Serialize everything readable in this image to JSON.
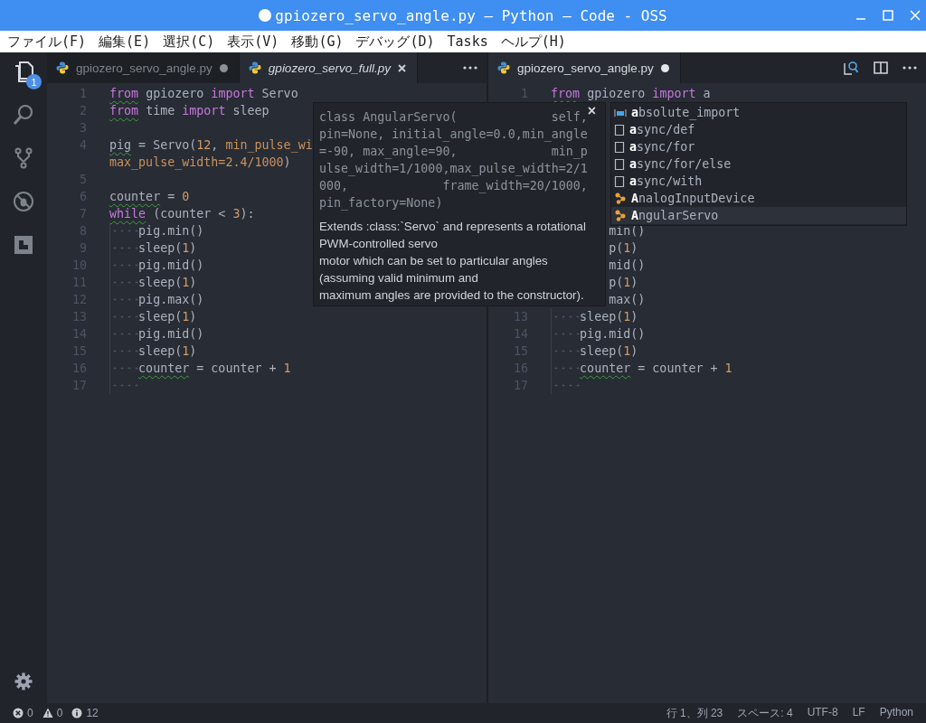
{
  "window": {
    "title": "gpiozero_servo_angle.py — Python — Code - OSS",
    "dirty": true
  },
  "menu": [
    "ファイル(F)",
    "編集(E)",
    "選択(C)",
    "表示(V)",
    "移動(G)",
    "デバッグ(D)",
    "Tasks",
    "ヘルプ(H)"
  ],
  "activity_bar": [
    {
      "kind": "files",
      "selected": true,
      "badge": "1"
    },
    {
      "kind": "search",
      "selected": false
    },
    {
      "kind": "source-control",
      "selected": false
    },
    {
      "kind": "debug",
      "selected": false
    },
    {
      "kind": "extensions",
      "selected": false
    }
  ],
  "editor_groups": [
    {
      "tabs": [
        {
          "label": "gpiozero_servo_angle.py",
          "selected": false,
          "dirty": true,
          "preview": false
        },
        {
          "label": "gpiozero_servo_full.py",
          "selected": true,
          "dirty": false,
          "preview": true
        }
      ],
      "lines": [
        {
          "kind": "code",
          "number": "1",
          "segments": [
            {
              "text": "from",
              "kind": "keyword",
              "warning": true
            },
            {
              "text": " gpiozero ",
              "kind": "plain"
            },
            {
              "text": "import",
              "kind": "keyword"
            },
            {
              "text": " Servo",
              "kind": "plain"
            }
          ]
        },
        {
          "kind": "code",
          "number": "2",
          "segments": [
            {
              "text": "from",
              "kind": "keyword",
              "warning": true
            },
            {
              "text": " time ",
              "kind": "plain"
            },
            {
              "text": "import",
              "kind": "keyword"
            },
            {
              "text": " sleep",
              "kind": "plain"
            }
          ]
        },
        {
          "kind": "code",
          "number": "3"
        },
        {
          "kind": "code",
          "number": "4",
          "segments": [
            {
              "text": "pig",
              "kind": "plain",
              "warning": true
            },
            {
              "text": " = Servo(",
              "kind": "plain"
            },
            {
              "text": "12",
              "kind": "number"
            },
            {
              "text": ", ",
              "kind": "plain"
            },
            {
              "text": "min_pulse_wi",
              "kind": "param"
            }
          ]
        },
        {
          "kind": "wrap",
          "segments": [
            {
              "text": "max_pulse_width=2.4/1000",
              "kind": "param"
            },
            {
              "text": ")",
              "kind": "plain"
            }
          ]
        },
        {
          "kind": "code",
          "number": "5"
        },
        {
          "kind": "code",
          "number": "6",
          "segments": [
            {
              "text": "counter",
              "kind": "plain",
              "warning": true
            },
            {
              "text": " = ",
              "kind": "plain"
            },
            {
              "text": "0",
              "kind": "number"
            }
          ]
        },
        {
          "kind": "code",
          "number": "7",
          "segments": [
            {
              "text": "while",
              "kind": "keyword",
              "warning": true
            },
            {
              "text": " (counter < ",
              "kind": "plain"
            },
            {
              "text": "3",
              "kind": "number"
            },
            {
              "text": "):",
              "kind": "plain"
            }
          ]
        },
        {
          "kind": "code",
          "number": "8",
          "indented": true,
          "segments": [
            {
              "text": "pig.min()",
              "kind": "plain"
            }
          ]
        },
        {
          "kind": "code",
          "number": "9",
          "indented": true,
          "segments": [
            {
              "text": "sleep(",
              "kind": "plain"
            },
            {
              "text": "1",
              "kind": "number"
            },
            {
              "text": ")",
              "kind": "plain"
            }
          ]
        },
        {
          "kind": "code",
          "number": "10",
          "indented": true,
          "segments": [
            {
              "text": "pig.mid()",
              "kind": "plain"
            }
          ]
        },
        {
          "kind": "code",
          "number": "11",
          "indented": true,
          "segments": [
            {
              "text": "sleep(",
              "kind": "plain"
            },
            {
              "text": "1",
              "kind": "number"
            },
            {
              "text": ")",
              "kind": "plain"
            }
          ]
        },
        {
          "kind": "code",
          "number": "12",
          "indented": true,
          "segments": [
            {
              "text": "pig.max()",
              "kind": "plain"
            }
          ]
        },
        {
          "kind": "code",
          "number": "13",
          "indented": true,
          "segments": [
            {
              "text": "sleep(",
              "kind": "plain"
            },
            {
              "text": "1",
              "kind": "number"
            },
            {
              "text": ")",
              "kind": "plain"
            }
          ]
        },
        {
          "kind": "code",
          "number": "14",
          "indented": true,
          "segments": [
            {
              "text": "pig.mid()",
              "kind": "plain"
            }
          ]
        },
        {
          "kind": "code",
          "number": "15",
          "indented": true,
          "segments": [
            {
              "text": "sleep(",
              "kind": "plain"
            },
            {
              "text": "1",
              "kind": "number"
            },
            {
              "text": ")",
              "kind": "plain"
            }
          ]
        },
        {
          "kind": "code",
          "number": "16",
          "indented": true,
          "segments": [
            {
              "text": "counter",
              "kind": "plain",
              "warning": true
            },
            {
              "text": " = counter + ",
              "kind": "plain"
            },
            {
              "text": "1",
              "kind": "number"
            }
          ]
        },
        {
          "kind": "code",
          "number": "17",
          "indented": true
        }
      ]
    },
    {
      "tabs": [
        {
          "label": "gpiozero_servo_angle.py",
          "selected": true,
          "dirty": true,
          "preview": false
        }
      ],
      "lines": [
        {
          "kind": "code",
          "number": "1",
          "segments": [
            {
              "text": "from",
              "kind": "keyword",
              "warning": true
            },
            {
              "text": " gpiozero ",
              "kind": "plain"
            },
            {
              "text": "import",
              "kind": "keyword"
            },
            {
              "text": " a",
              "kind": "plain"
            }
          ]
        },
        {
          "kind": "hidden"
        },
        {
          "kind": "hidden"
        },
        {
          "kind": "hidden"
        },
        {
          "kind": "hidden"
        },
        {
          "kind": "hidden"
        },
        {
          "kind": "hidden"
        },
        {
          "kind": "hidden"
        },
        {
          "kind": "covered",
          "segments": [
            {
              "text": "min()",
              "kind": "plain"
            }
          ]
        },
        {
          "kind": "covered",
          "segments": [
            {
              "text": "p(",
              "kind": "plain"
            },
            {
              "text": "1",
              "kind": "number"
            },
            {
              "text": ")",
              "kind": "plain"
            }
          ]
        },
        {
          "kind": "covered",
          "segments": [
            {
              "text": "mid()",
              "kind": "plain"
            }
          ]
        },
        {
          "kind": "covered",
          "segments": [
            {
              "text": "p(",
              "kind": "plain"
            },
            {
              "text": "1",
              "kind": "number"
            },
            {
              "text": ")",
              "kind": "plain"
            }
          ]
        },
        {
          "kind": "covered",
          "segments": [
            {
              "text": "max()",
              "kind": "plain"
            }
          ]
        },
        {
          "kind": "code",
          "number": "13",
          "indented": true,
          "segments": [
            {
              "text": "sleep(",
              "kind": "plain"
            },
            {
              "text": "1",
              "kind": "number"
            },
            {
              "text": ")",
              "kind": "plain"
            }
          ]
        },
        {
          "kind": "code",
          "number": "14",
          "indented": true,
          "segments": [
            {
              "text": "pig.mid()",
              "kind": "plain"
            }
          ]
        },
        {
          "kind": "code",
          "number": "15",
          "indented": true,
          "segments": [
            {
              "text": "sleep(",
              "kind": "plain"
            },
            {
              "text": "1",
              "kind": "number"
            },
            {
              "text": ")",
              "kind": "plain"
            }
          ]
        },
        {
          "kind": "code",
          "number": "16",
          "indented": true,
          "segments": [
            {
              "text": "counter",
              "kind": "plain",
              "warning": true
            },
            {
              "text": " = counter + ",
              "kind": "plain"
            },
            {
              "text": "1",
              "kind": "number"
            }
          ]
        },
        {
          "kind": "code",
          "number": "17",
          "indented": true
        }
      ]
    }
  ],
  "hover": {
    "close": "×",
    "signature": [
      "class AngularServo(             self,",
      "pin=None, initial_angle=0.0,min_angle",
      "=-90, max_angle=90,             min_p",
      "ulse_width=1/1000,max_pulse_width=2/1",
      "000,             frame_width=20/1000,",
      "pin_factory=None)"
    ],
    "docs": [
      "Extends :class:`Servo` and represents a rotational",
      "PWM-controlled servo",
      "motor which can be set to particular angles",
      "(assuming valid minimum and",
      "maximum angles are provided to the constructor)."
    ]
  },
  "suggestions": [
    {
      "kind": "keyword",
      "label": "**a**bsolute_import",
      "selected": false
    },
    {
      "kind": "snippet",
      "label": "**a**sync/def",
      "selected": false
    },
    {
      "kind": "snippet",
      "label": "**a**sync/for",
      "selected": false
    },
    {
      "kind": "snippet",
      "label": "**a**sync/for/else",
      "selected": false
    },
    {
      "kind": "snippet",
      "label": "**a**sync/with",
      "selected": false
    },
    {
      "kind": "class",
      "label": "**A**nalogInputDevice",
      "selected": false
    },
    {
      "kind": "class",
      "label": "**A**ngularServo",
      "selected": true
    }
  ],
  "status_bar": {
    "errors": "0",
    "warnings": "0",
    "infos": "12",
    "right": [
      "行 1、列 23",
      "スペース: 4",
      "UTF-8",
      "LF",
      "Python"
    ]
  }
}
